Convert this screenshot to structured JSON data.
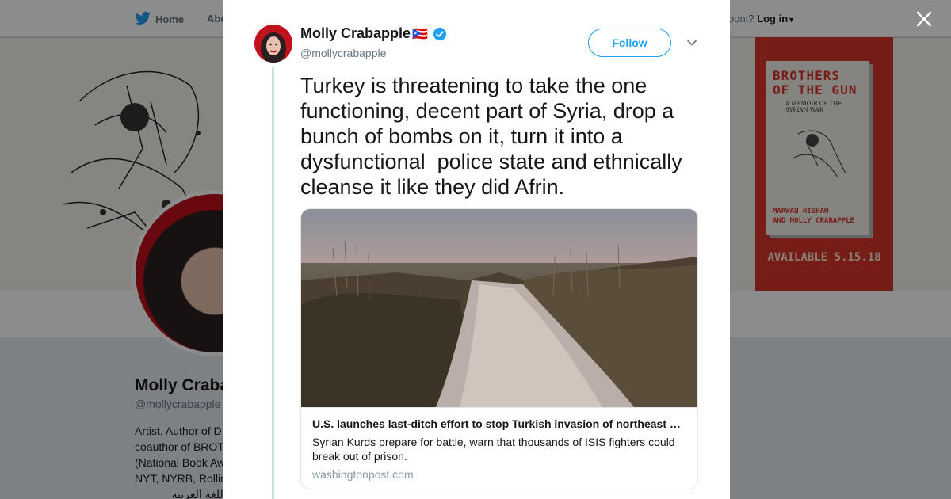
{
  "background": {
    "nav": {
      "home_label": "Home",
      "about_label": "Abo",
      "account_prompt": "ccount?",
      "login_label": "Log in"
    },
    "book": {
      "title_lines": [
        "BROTHERS",
        "OF THE GUN"
      ],
      "subtitle": "A MEMOIR OF THE SYRIAN WAR",
      "author_1": "MARWAN HISHAM",
      "author_2": "AND MOLLY CRABAPPLE",
      "availability": "AVAILABLE 5.15.18"
    },
    "profile": {
      "name": "Molly Craba",
      "handle": "@mollycrabapple",
      "bio_lines": [
        "Artist. Author of D",
        "coauthor of BROT",
        "(National Book Aw",
        "NYT, NYRB, Rollin",
        "باللغة العربية"
      ]
    }
  },
  "tweet": {
    "author_name": "Molly Crabapple",
    "flag": "🇵🇷",
    "verified": true,
    "handle": "@mollycrabapple",
    "follow_label": "Follow",
    "text": "Turkey is threatening to take the one functioning, decent part of Syria, drop a bunch of bombs on it, turn it into a dysfunctional  police state and ethnically cleanse it like they did Afrin.",
    "card": {
      "title": "U.S. launches last-ditch effort to stop Turkish invasion of northeast Syria",
      "description": "Syrian Kurds prepare for battle, warn that thousands of ISIS fighters could break out of prison.",
      "domain": "washingtonpost.com"
    }
  },
  "colors": {
    "twitter_blue": "#1da1f2",
    "verified_blue": "#1da1f2",
    "book_red": "#d9362b"
  },
  "icons": {
    "nav_home": "twitter-bird-icon",
    "close": "close-icon",
    "verified": "verified-badge-icon",
    "more": "chevron-down-icon"
  }
}
